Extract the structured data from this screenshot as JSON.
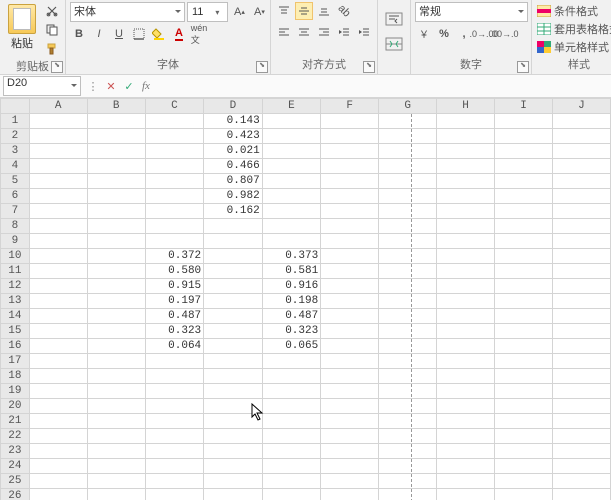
{
  "ribbon": {
    "clipboard": {
      "label": "剪贴板",
      "paste": "粘贴"
    },
    "font": {
      "label": "字体",
      "name": "宋体",
      "size": "11"
    },
    "align": {
      "label": "对齐方式"
    },
    "number": {
      "label": "数字",
      "format": "常规"
    },
    "styles": {
      "label": "样式",
      "cond": "条件格式",
      "table": "套用表格格式",
      "cell": "单元格样式"
    }
  },
  "formula_bar": {
    "cell_ref": "D20",
    "value": ""
  },
  "columns": [
    "",
    "A",
    "B",
    "C",
    "D",
    "E",
    "F",
    "G",
    "H",
    "I",
    "J"
  ],
  "rows": [
    {
      "n": 1,
      "D": "0.143"
    },
    {
      "n": 2,
      "D": "0.423"
    },
    {
      "n": 3,
      "D": "0.021"
    },
    {
      "n": 4,
      "D": "0.466"
    },
    {
      "n": 5,
      "D": "0.807"
    },
    {
      "n": 6,
      "D": "0.982"
    },
    {
      "n": 7,
      "D": "0.162"
    },
    {
      "n": 8
    },
    {
      "n": 9
    },
    {
      "n": 10,
      "C": "0.372",
      "E": "0.373"
    },
    {
      "n": 11,
      "C": "0.580",
      "E": "0.581"
    },
    {
      "n": 12,
      "C": "0.915",
      "E": "0.916"
    },
    {
      "n": 13,
      "C": "0.197",
      "E": "0.198"
    },
    {
      "n": 14,
      "C": "0.487",
      "E": "0.487"
    },
    {
      "n": 15,
      "C": "0.323",
      "E": "0.323"
    },
    {
      "n": 16,
      "C": "0.064",
      "E": "0.065"
    },
    {
      "n": 17
    },
    {
      "n": 18
    },
    {
      "n": 19
    },
    {
      "n": 20
    },
    {
      "n": 21
    },
    {
      "n": 22
    },
    {
      "n": 23
    },
    {
      "n": 24
    },
    {
      "n": 25
    },
    {
      "n": 26
    }
  ]
}
